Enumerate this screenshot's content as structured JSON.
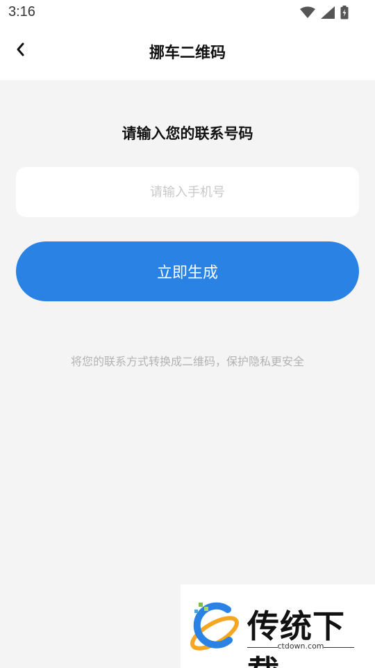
{
  "status_bar": {
    "time": "3:16",
    "icons": [
      "wifi-icon",
      "signal-icon",
      "battery-icon"
    ]
  },
  "app_bar": {
    "back_icon": "chevron-left-icon",
    "title": "挪车二维码"
  },
  "main": {
    "heading": "请输入您的联系号码",
    "phone_input": {
      "placeholder": "请输入手机号",
      "value": ""
    },
    "generate_button": "立即生成",
    "hint": "将您的联系方式转换成二维码，保护隐私更安全"
  },
  "watermark": {
    "brand_text": "传统下载",
    "url": "ctdown.com"
  },
  "colors": {
    "accent": "#2a82e4",
    "background": "#f4f4f4",
    "surface": "#ffffff",
    "hint_text": "#b3b3b3"
  }
}
